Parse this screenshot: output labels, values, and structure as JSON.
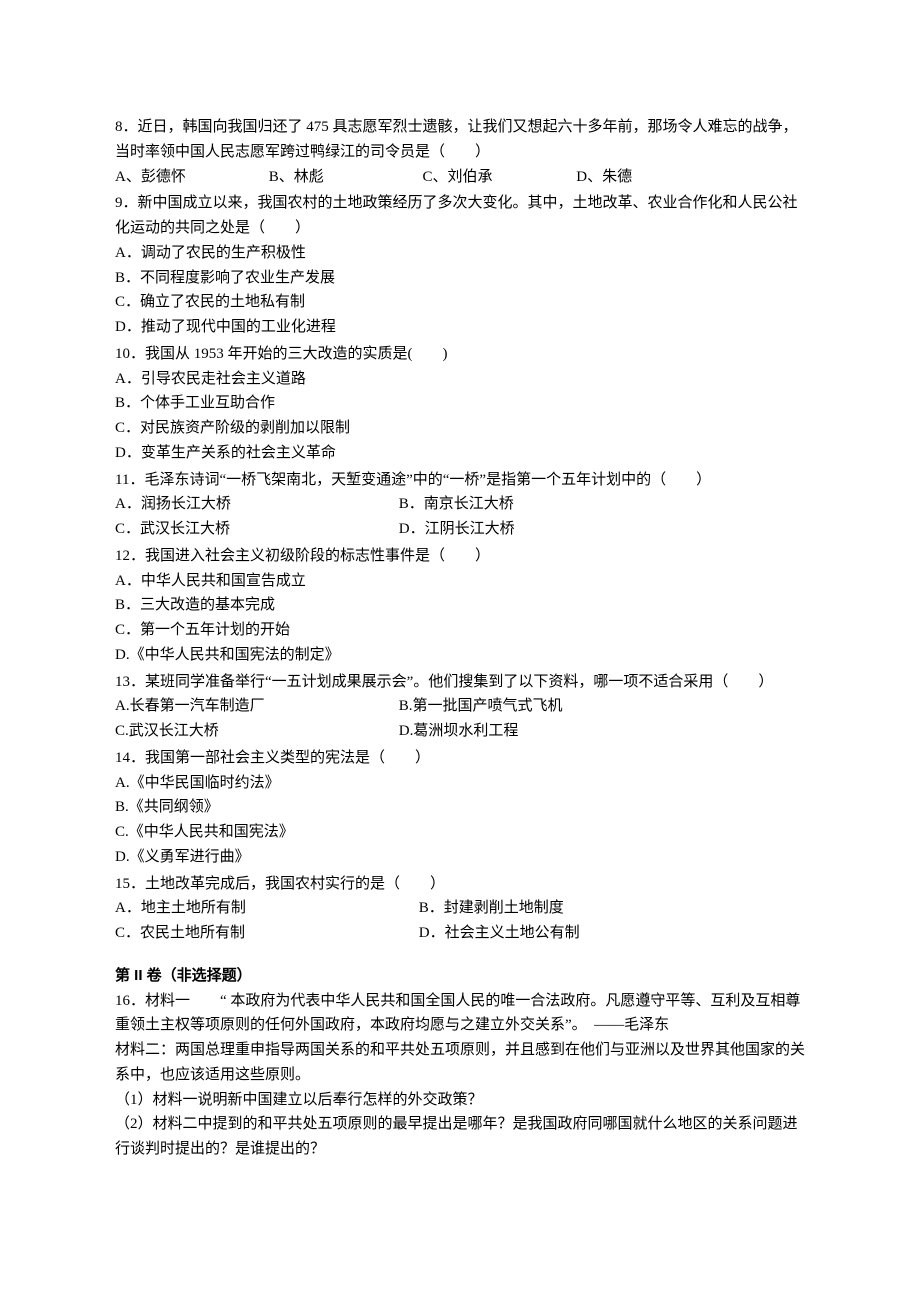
{
  "q8": {
    "stem": "8．近日，韩国向我国归还了 475 具志愿军烈士遗骸，让我们又想起六十多年前，那场令人难忘的战争，当时率领中国人民志愿军跨过鸭绿江的司令员是（　　）",
    "a": "A、彭德怀",
    "b": "B、林彪",
    "c": "C、刘伯承",
    "d": "D、朱德"
  },
  "q9": {
    "stem": "9．新中国成立以来，我国农村的土地政策经历了多次大变化。其中，土地改革、农业合作化和人民公社化运动的共同之处是（　　）",
    "a": "A．调动了农民的生产积极性",
    "b": "B．不同程度影响了农业生产发展",
    "c": "C．确立了农民的土地私有制",
    "d": "D．推动了现代中国的工业化进程"
  },
  "q10": {
    "stem": "10．我国从 1953 年开始的三大改造的实质是(　　)",
    "a": "A．引导农民走社会主义道路",
    "b": "B．个体手工业互助合作",
    "c": "C．对民族资产阶级的剥削加以限制",
    "d": "D．变革生产关系的社会主义革命"
  },
  "q11": {
    "stem": "11．毛泽东诗词“一桥飞架南北，天堑变通途”中的“一桥”是指第一个五年计划中的（　　）",
    "a": "A．润扬长江大桥",
    "b": "B．南京长江大桥",
    "c": "C．武汉长江大桥",
    "d": "D．江阴长江大桥"
  },
  "q12": {
    "stem": "12．我国进入社会主义初级阶段的标志性事件是（　　）",
    "a": "A．中华人民共和国宣告成立",
    "b": "B．三大改造的基本完成",
    "c": "C．第一个五年计划的开始",
    "d": "D.《中华人民共和国宪法的制定》"
  },
  "q13": {
    "stem": "13．某班同学准备举行“一五计划成果展示会”。他们搜集到了以下资料，哪一项不适合采用（　　）",
    "a": "A.长春第一汽车制造厂",
    "b": "B.第一批国产喷气式飞机",
    "c": "C.武汉长江大桥",
    "d": "D.葛洲坝水利工程"
  },
  "q14": {
    "stem": "14．我国第一部社会主义类型的宪法是（　　）",
    "a": "A.《中华民国临时约法》",
    "b": "B.《共同纲领》",
    "c": "C.《中华人民共和国宪法》",
    "d": "D.《义勇军进行曲》"
  },
  "q15": {
    "stem": "15．土地改革完成后，我国农村实行的是（　　）",
    "a": "A．地主土地所有制",
    "b": "B．封建剥削土地制度",
    "c": "C．农民土地所有制",
    "d": "D．社会主义土地公有制"
  },
  "section2": {
    "heading": "第 II 卷（非选择题）",
    "q16": {
      "mat1": "16．材料一　　“ 本政府为代表中华人民共和国全国人民的唯一合法政府。凡愿遵守平等、互利及互相尊重领土主权等项原则的任何外国政府，本政府均愿与之建立外交关系”。　——毛泽东",
      "mat2": "材料二：两国总理重申指导两国关系的和平共处五项原则，并且感到在他们与亚洲以及世界其他国家的关系中，也应该适用这些原则。",
      "sub1": "（1）材料一说明新中国建立以后奉行怎样的外交政策？",
      "sub2": "（2）材料二中提到的和平共处五项原则的最早提出是哪年？是我国政府同哪国就什么地区的关系问题进行谈判时提出的？是谁提出的？"
    }
  }
}
